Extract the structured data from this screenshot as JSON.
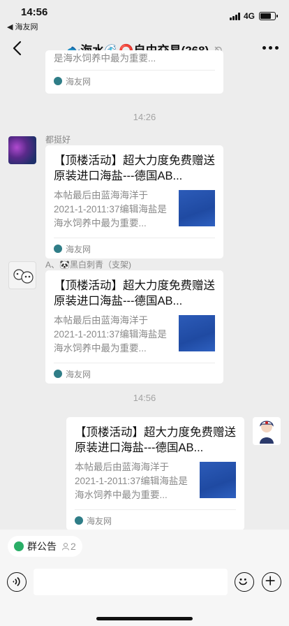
{
  "status_bar": {
    "time": "14:56",
    "back_app": "◀ 海友网",
    "network": "4G",
    "battery_level": 0.8
  },
  "nav": {
    "title": "🐟海水🌊⭕自由交易(268)",
    "back_icon": "chevron-left-icon",
    "mute_icon": "bell-off-icon",
    "more_icon": "ellipsis-icon"
  },
  "messages": [
    {
      "kind": "partial-card",
      "desc_partial": "是海水饲养中最为重要...",
      "source": "海友网"
    },
    {
      "kind": "timestamp",
      "text": "14:26"
    },
    {
      "kind": "card",
      "sender": "都挺好",
      "title": "【顶楼活动】超大力度免费赠送原装进口海盐---德国AB...",
      "desc": "本帖最后由蓝海海洋于2021-1-2011:37编辑海盐是海水饲养中最为重要...",
      "source": "海友网"
    },
    {
      "kind": "card",
      "sender": "A、🐼黑白刺青（支架)",
      "title": "【顶楼活动】超大力度免费赠送原装进口海盐---德国AB...",
      "desc": "本帖最后由蓝海海洋于2021-1-2011:37编辑海盐是海水饲养中最为重要...",
      "source": "海友网"
    },
    {
      "kind": "timestamp",
      "text": "14:56"
    },
    {
      "kind": "card-self",
      "title": "【顶楼活动】超大力度免费赠送原装进口海盐---德国AB...",
      "desc": "本帖最后由蓝海海洋于2021-1-2011:37编辑海盐是海水饲养中最为重要...",
      "source": "海友网"
    }
  ],
  "bottom": {
    "notice_label": "群公告",
    "member_count": "2",
    "voice_icon": "voice-icon",
    "emoji_icon": "emoji-icon",
    "plus_icon": "plus-icon"
  },
  "colors": {
    "background": "#ededed",
    "card": "#ffffff",
    "notice_green": "#2aae67",
    "thumb_blue": "#2c5bb8"
  }
}
